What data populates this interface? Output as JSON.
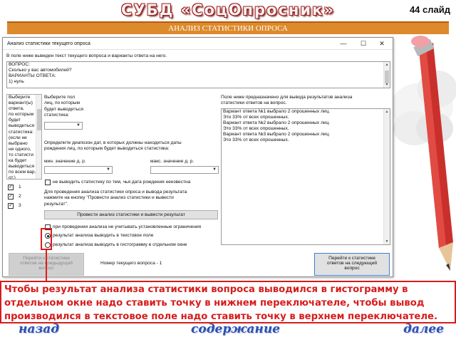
{
  "slide": {
    "title": "СУБД «СоцОпросник»",
    "slide_number": "44 слайд",
    "banner": "АНАЛИЗ СТАТИСТИКИ ОПРОСА"
  },
  "window": {
    "title": "Анализ статистики текущего опроса",
    "minimize_icon": "minimize-icon",
    "maximize_icon": "maximize-icon",
    "close_icon": "close-icon",
    "instruction": "В поле ниже выведен текст текущего вопроса и варианты ответа на него.",
    "question_lines": [
      "ВОПРОС:",
      "Сколько у вас автомобилей?",
      "ВАРИАНТЫ ОТВЕТА:",
      "1) нуль"
    ],
    "choose_variants_label": [
      "Выберите",
      "вариант(ы)",
      "ответа,",
      "по которым",
      "будет",
      "выводиться",
      "статистика:",
      "(если не",
      "выбрано",
      "ни одного,",
      "то статисти",
      "ка будет",
      "выводиться",
      "по всем вар. от.)"
    ],
    "variant_checkboxes": [
      {
        "label": "1",
        "checked": true
      },
      {
        "label": "2",
        "checked": true
      },
      {
        "label": "3",
        "checked": true
      }
    ],
    "gender_label": [
      "Выберите пол",
      "лиц, по которым",
      "будет выводиться",
      "статистика:"
    ],
    "gender_value": "",
    "date_range_label": [
      "Определите диапозон дат, в которых должны находиться даты",
      "рождения лиц, по которым будет выводиться статистика:"
    ],
    "min_date_label": "мин. значение д. р.",
    "max_date_label": "макс. значение д. р.",
    "min_date_value": "",
    "max_date_value": "",
    "unknown_birth_label": "не выводить статистику по тем, чья дата рождения неизвестна",
    "unknown_birth_checked": false,
    "analysis_hint": [
      "Для проведения анализа статистики опроса и вывода результата",
      "нажмите на кнопку \"Провести анализ статистики и вывести",
      "результат\"."
    ],
    "analyze_button": "Провести анализ статистики и вывести результат",
    "ignore_limits_label": "при проведении анализа не учитывать установленные ограничения",
    "ignore_limits_checked": false,
    "radio_text_label": "результат анализа выводить в текстовое поле",
    "radio_text_selected": true,
    "radio_hist_label": "результат анализа выводить в гистограмму в отдельном окне",
    "radio_hist_selected": false,
    "results_label": [
      "Поле ниже предназначено для вывода результатов анализа",
      "статистики ответов на вопрос."
    ],
    "results_lines": [
      "Вариант ответа №1 выбрало 2 опрошенных лиц.",
      "Это 33% от всех опрошенных.",
      "Вариант ответа №2 выбрало 2 опрошенных лиц.",
      "Это 33% от всех опрошенных.",
      "Вариант ответа №3 выбрало 2 опрошенных лиц.",
      "Это 33% от всех опрошенных."
    ],
    "prev_button": [
      "Перейти к статистике",
      "ответов на предыдущий",
      "вопрос"
    ],
    "current_question": "Номер текущего вопроса - 1",
    "next_button": [
      "Перейти к статистике",
      "ответов на следующий",
      "вопрос"
    ]
  },
  "note": "Чтобы результат анализа статистики вопроса выводился в гистограмму в отдельном окне надо ставить точку в нижнем переключателе, чтобы вывод производился в текстовое поле надо ставить точку в верхнем переключателе.",
  "nav": {
    "back": "назад",
    "contents": "содержание",
    "next": "далее"
  },
  "colors": {
    "banner": "#dc8a2b",
    "accent_red": "#d61c1c",
    "nav_blue": "#2d4fb0"
  }
}
